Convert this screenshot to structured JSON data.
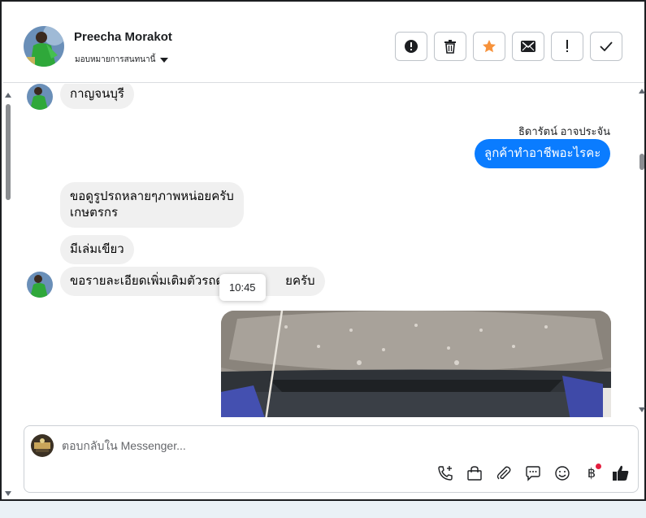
{
  "header": {
    "contact_name": "Preecha Morakot",
    "assign_label": "มอบหมายการสนทนานี้",
    "actions": [
      {
        "name": "spam-button",
        "icon": "alert-circle-icon"
      },
      {
        "name": "delete-button",
        "icon": "trash-icon"
      },
      {
        "name": "star-button",
        "icon": "star-icon"
      },
      {
        "name": "mark-unread-button",
        "icon": "envelope-icon"
      },
      {
        "name": "follow-up-button",
        "icon": "exclamation-icon"
      },
      {
        "name": "mark-done-button",
        "icon": "check-icon"
      }
    ],
    "star_color": "#f7923b"
  },
  "messages": {
    "m1": "กาญจนบุรี",
    "agent_name": "ธิดารัตน์ อาจประจัน",
    "m2": "ลูกค้าทำอาชีพอะไรคะ",
    "m3_line1": "ขอดูรูปรถหลายๆภาพหน่อยครับ",
    "m3_line2": "เกษตรกร",
    "m4": "มีเล่มเขียว",
    "m5_part1": "ขอรายละเอียดเพิ่มเติมตัวรถด",
    "m5_part2": "ยครับ",
    "tooltip_time": "10:45",
    "outgoing_color": "#0a7cff"
  },
  "composer": {
    "placeholder": "ตอบกลับใน Messenger...",
    "tools": [
      "call-add-icon",
      "shopping-bag-icon",
      "paperclip-icon",
      "chat-bubble-icon",
      "smiley-icon",
      "baht-icon",
      "thumbs-up-icon"
    ]
  }
}
